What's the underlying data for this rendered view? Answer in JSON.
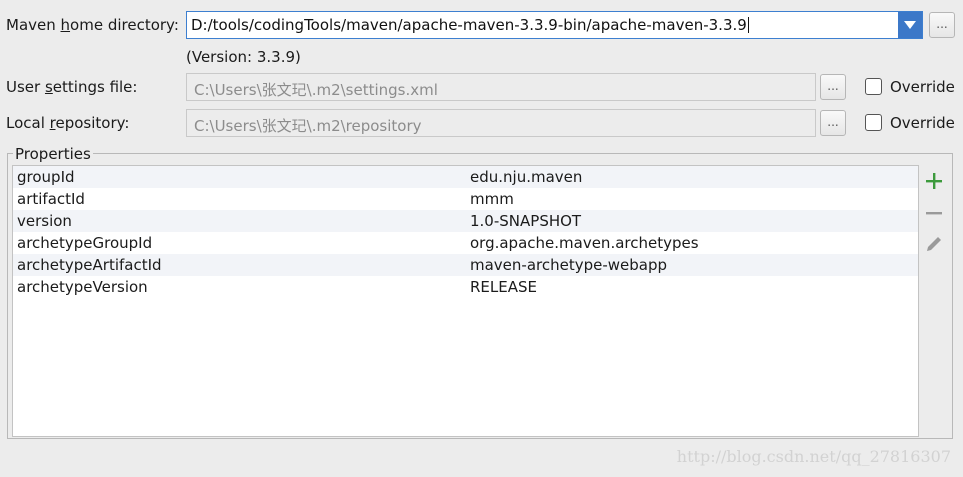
{
  "maven_home": {
    "label_pre": "Maven ",
    "label_u": "h",
    "label_post": "ome directory:",
    "value": "D:/tools/codingTools/maven/apache-maven-3.3.9-bin/apache-maven-3.3.9",
    "version": "(Version: 3.3.9)",
    "browse": "..."
  },
  "user_settings": {
    "label_pre": "User ",
    "label_u": "s",
    "label_post": "ettings file:",
    "value": "C:\\Users\\张文玘\\.m2\\settings.xml",
    "browse": "...",
    "override": "Override"
  },
  "local_repo": {
    "label_pre": "Local ",
    "label_u": "r",
    "label_post": "epository:",
    "value": "C:\\Users\\张文玘\\.m2\\repository",
    "browse": "...",
    "override": "Override"
  },
  "properties": {
    "title": "Properties",
    "rows": [
      {
        "key": "groupId",
        "value": "edu.nju.maven"
      },
      {
        "key": "artifactId",
        "value": "mmm"
      },
      {
        "key": "version",
        "value": "1.0-SNAPSHOT"
      },
      {
        "key": "archetypeGroupId",
        "value": "org.apache.maven.archetypes"
      },
      {
        "key": "archetypeArtifactId",
        "value": "maven-archetype-webapp"
      },
      {
        "key": "archetypeVersion",
        "value": "RELEASE"
      }
    ],
    "actions": [
      "plus-icon",
      "minus-icon",
      "pencil-icon"
    ]
  },
  "colors": {
    "accent": "#3c78c8",
    "add": "#3c9a3c",
    "disabled": "#9a9a9a"
  },
  "watermark": "http://blog.csdn.net/qq_27816307"
}
